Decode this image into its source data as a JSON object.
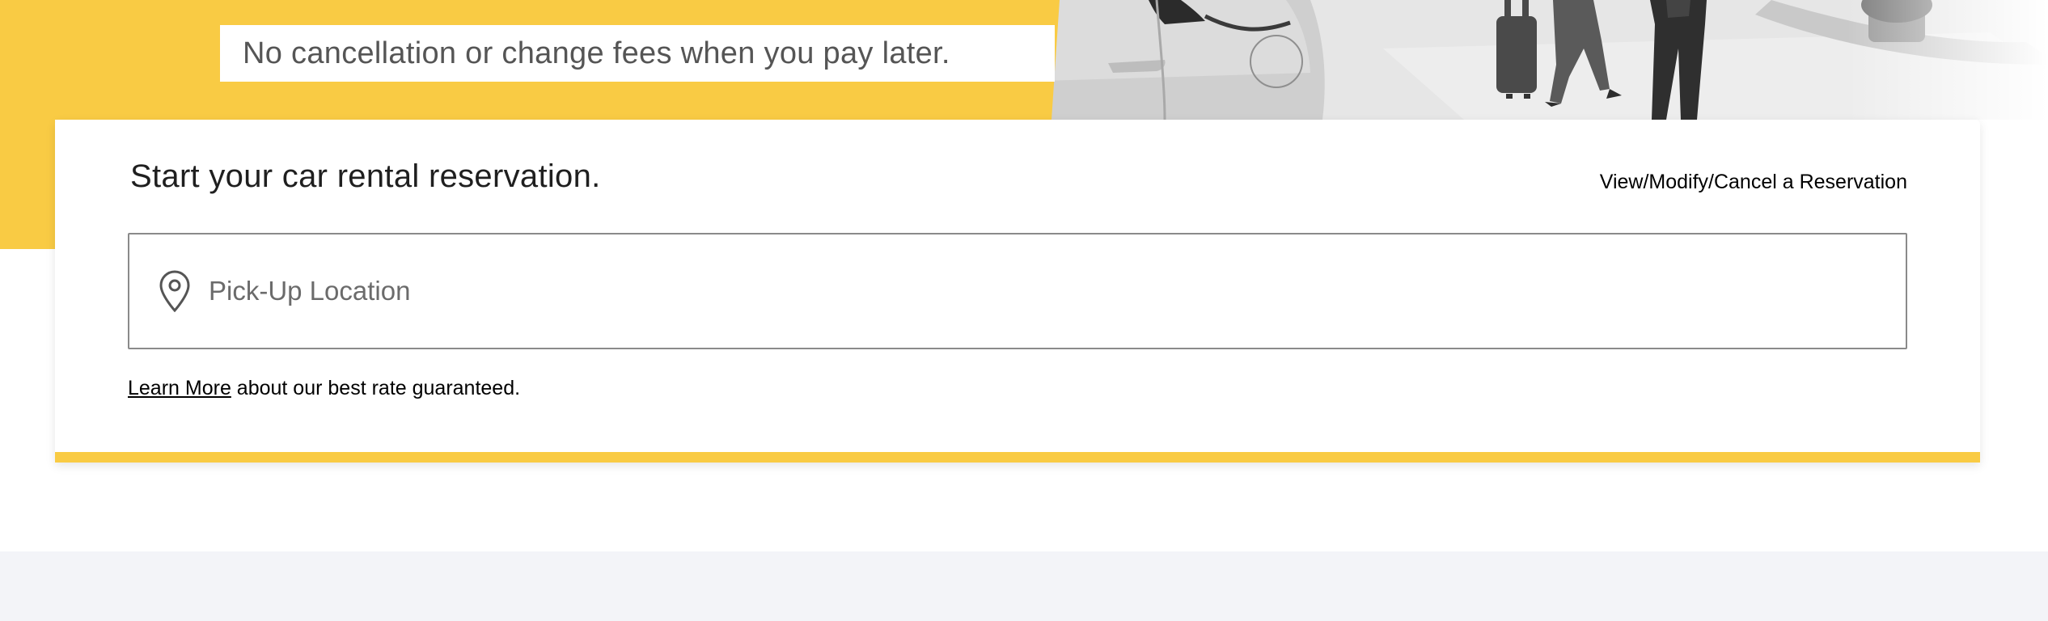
{
  "hero": {
    "promo_text": "No cancellation or change fees when you pay later."
  },
  "reservation": {
    "title": "Start your car rental reservation.",
    "manage_link": "View/Modify/Cancel a Reservation",
    "location_placeholder": "Pick-Up Location",
    "learn_more_label": "Learn More",
    "rate_note_text": " about our best rate guaranteed."
  },
  "colors": {
    "brand_yellow": "#f9cb44",
    "footer_band": "#f3f4f8"
  },
  "icons": {
    "location": "map-pin-icon"
  }
}
